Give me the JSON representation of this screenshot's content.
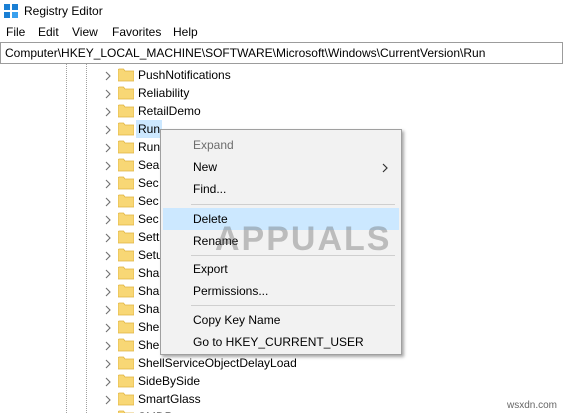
{
  "window": {
    "title": "Registry Editor"
  },
  "menu": [
    "File",
    "Edit",
    "View",
    "Favorites",
    "Help"
  ],
  "address": "Computer\\HKEY_LOCAL_MACHINE\\SOFTWARE\\Microsoft\\Windows\\CurrentVersion\\Run",
  "tree": {
    "rows": [
      {
        "label": "PushNotifications"
      },
      {
        "label": "Reliability"
      },
      {
        "label": "RetailDemo"
      },
      {
        "label": "Run",
        "selected": true
      },
      {
        "label": "Run"
      },
      {
        "label": "Sea"
      },
      {
        "label": "Sec"
      },
      {
        "label": "Sec"
      },
      {
        "label": "Sec"
      },
      {
        "label": "Sett"
      },
      {
        "label": "Setu"
      },
      {
        "label": "Sha"
      },
      {
        "label": "Sha"
      },
      {
        "label": "Sha"
      },
      {
        "label": "She"
      },
      {
        "label": "She"
      },
      {
        "label": "ShellServiceObjectDelayLoad"
      },
      {
        "label": "SideBySide"
      },
      {
        "label": "SmartGlass"
      },
      {
        "label": "SMDP"
      }
    ]
  },
  "context_menu": {
    "expand": "Expand",
    "new": "New",
    "find": "Find...",
    "delete": "Delete",
    "rename": "Rename",
    "export": "Export",
    "permissions": "Permissions...",
    "copy_key_name": "Copy Key Name",
    "goto_hkcu": "Go to HKEY_CURRENT_USER"
  },
  "watermark": "APPUALS",
  "credit": "wsxdn.com",
  "colors": {
    "folder": "#f8d775",
    "folder_dark": "#e0b440",
    "hover": "#cce8ff",
    "menu_bg": "#f2f2f2"
  }
}
